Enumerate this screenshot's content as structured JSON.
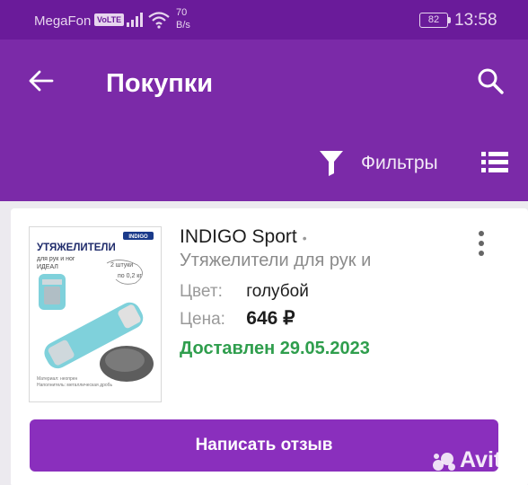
{
  "status_bar": {
    "carrier": "MegaFon",
    "volte": "VoLTE",
    "speed_value": "70",
    "speed_unit": "B/s",
    "battery": "82",
    "time": "13:58"
  },
  "app_bar": {
    "title": "Покупки",
    "filters_label": "Фильтры"
  },
  "order": {
    "brand": "INDIGO Sport",
    "title": "Утяжелители для рук и",
    "color_label": "Цвет:",
    "color_value": "голубой",
    "price_label": "Цена:",
    "price_value": "646 ₽",
    "status": "Доставлен 29.05.2023",
    "review_button": "Написать отзыв",
    "image_text": {
      "logo": "INDIGO",
      "heading": "УТЯЖЕЛИТЕЛИ",
      "subheading": "для рук и ног",
      "model": "ИДЕАЛ",
      "qty": "2 штуки",
      "weight": "по 0,2 кг",
      "material_line1": "Материал: неопрен",
      "material_line2": "Наполнитель: металлическая дробь"
    }
  },
  "watermark": "Avito",
  "colors": {
    "status_bar": "#6a1b9a",
    "app_bar": "#7b2aa8",
    "button": "#8a2fbd",
    "delivered": "#2f9e4d"
  }
}
